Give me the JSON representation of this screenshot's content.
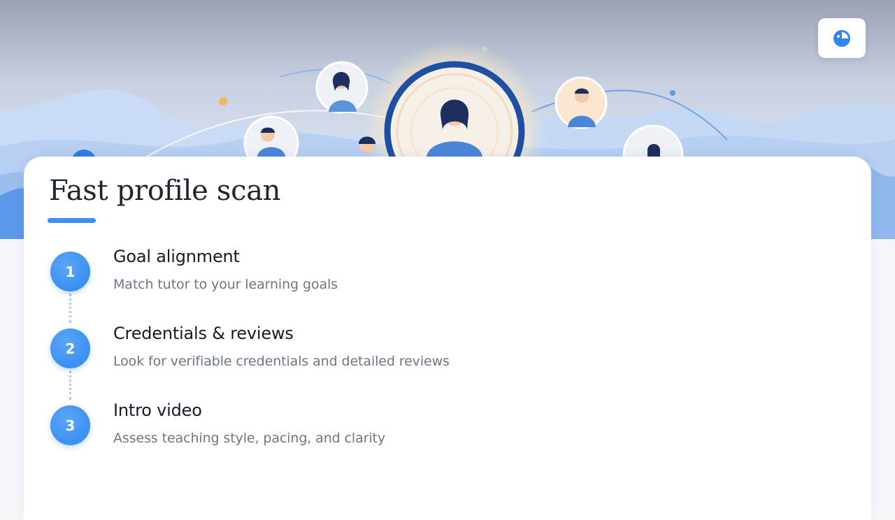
{
  "header": {
    "logo_icon": "chat-bubble-logo-icon"
  },
  "main": {
    "title": "Fast profile scan",
    "steps": [
      {
        "number": "1",
        "title": "Goal alignment",
        "description": "Match tutor to your learning goals"
      },
      {
        "number": "2",
        "title": "Credentials & reviews",
        "description": "Look for verifiable credentials and detailed reviews"
      },
      {
        "number": "3",
        "title": "Intro video",
        "description": "Assess teaching style, pacing, and clarity"
      }
    ]
  },
  "colors": {
    "accent": "#3d8ff0",
    "badge": "#2f86ee",
    "title_text": "#1e2430",
    "body_text": "#6d7686"
  }
}
